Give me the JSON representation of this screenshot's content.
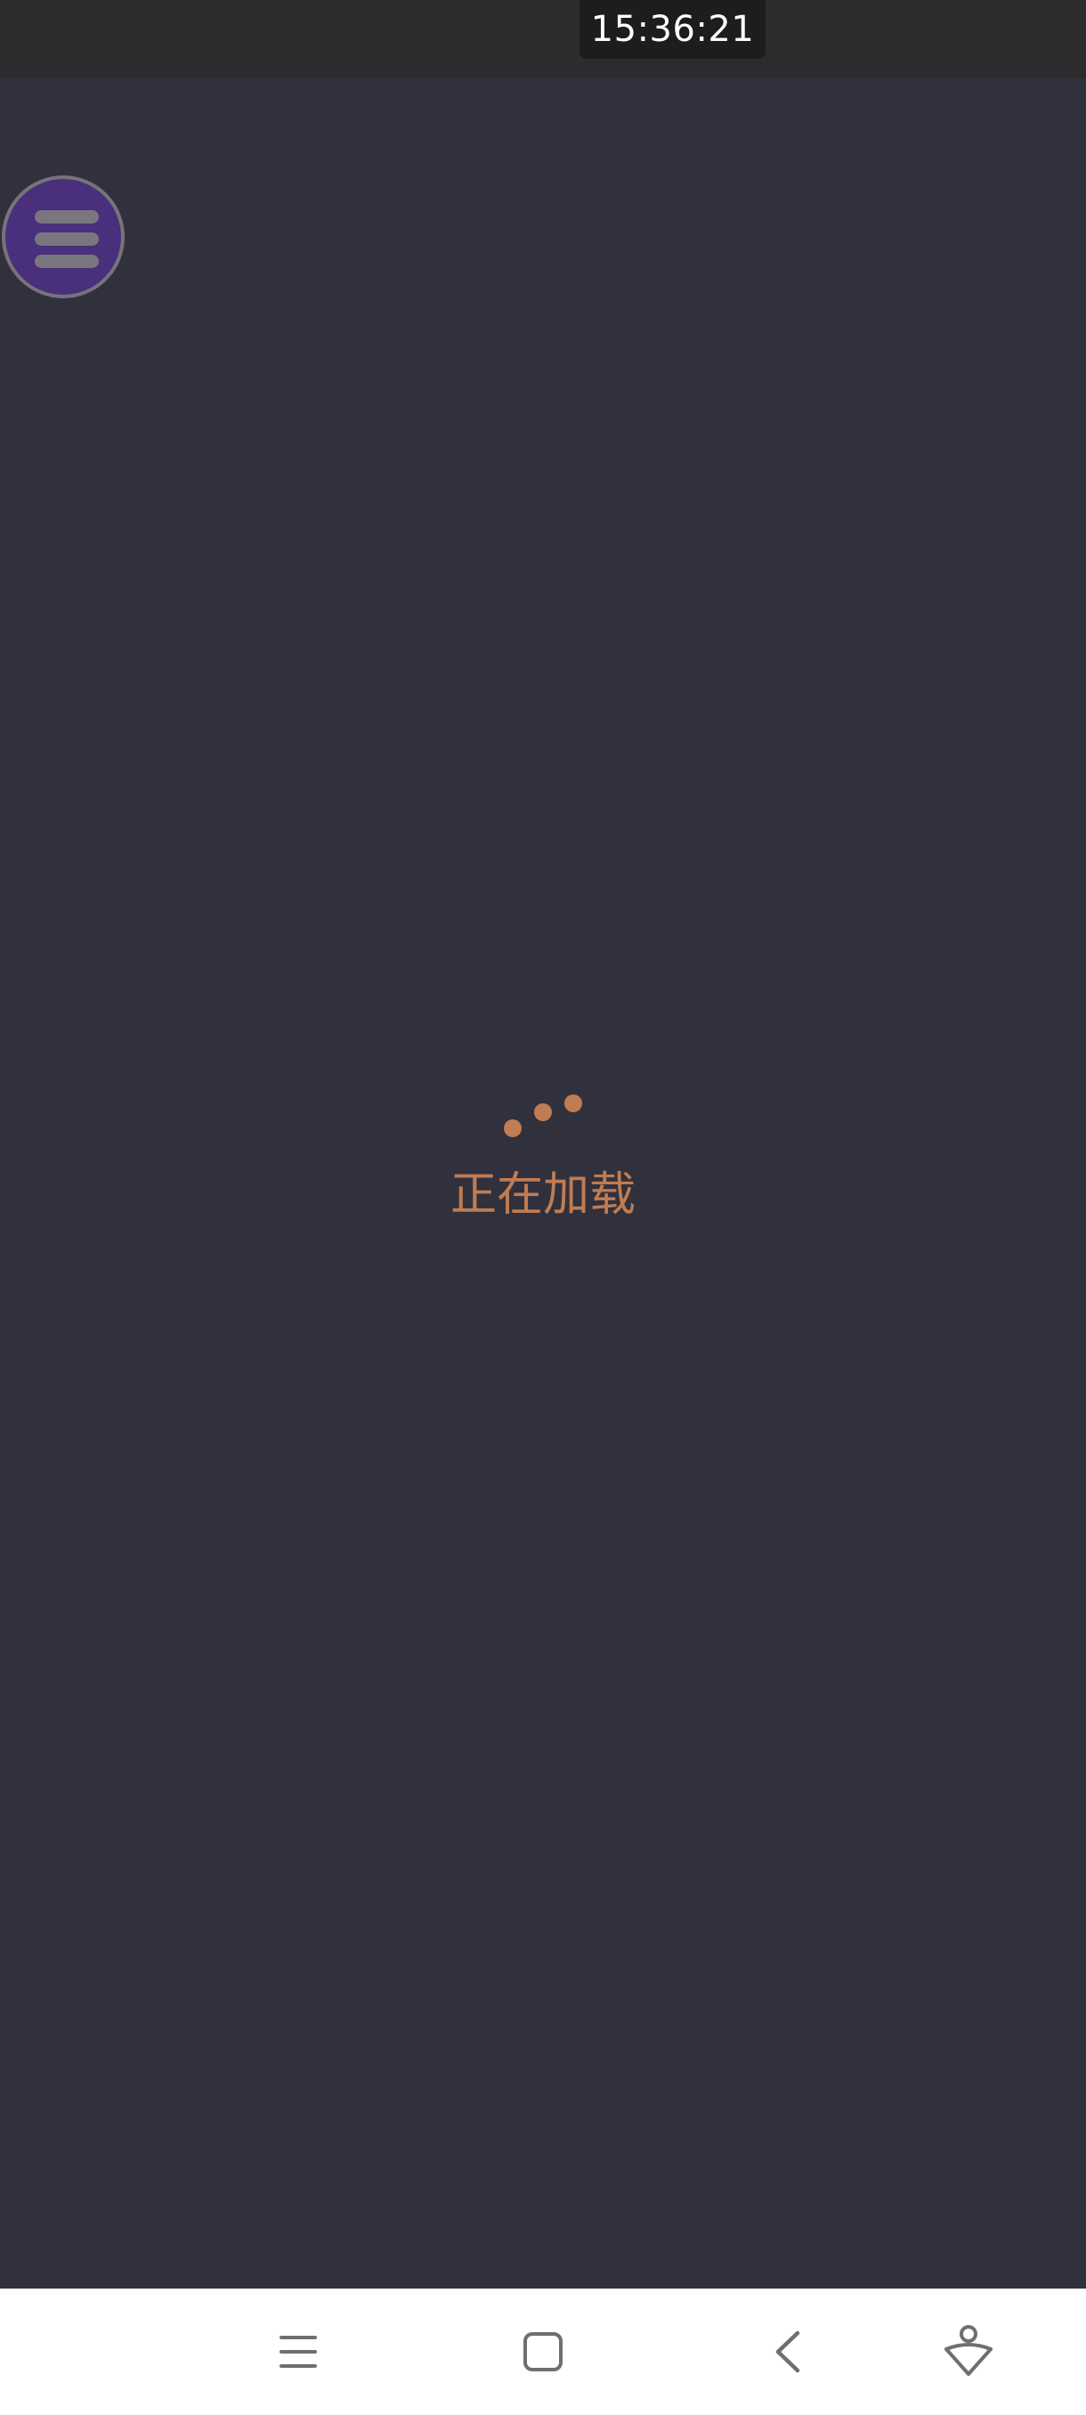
{
  "status_bar": {
    "time": "15:36:21"
  },
  "menu_button": {
    "icon": "hamburger-menu-icon",
    "color": "#4a2f7c"
  },
  "loading": {
    "text": "正在加载",
    "accent_color": "#c07c52",
    "icon": "loading-dots-icon"
  },
  "system_nav": {
    "buttons": [
      {
        "icon": "recent-apps-icon"
      },
      {
        "icon": "home-icon"
      },
      {
        "icon": "back-icon"
      },
      {
        "icon": "assistant-icon"
      }
    ]
  },
  "colors": {
    "background": "#31313d",
    "top_bar": "#2c2c2e",
    "nav_bar": "#ffffff"
  }
}
